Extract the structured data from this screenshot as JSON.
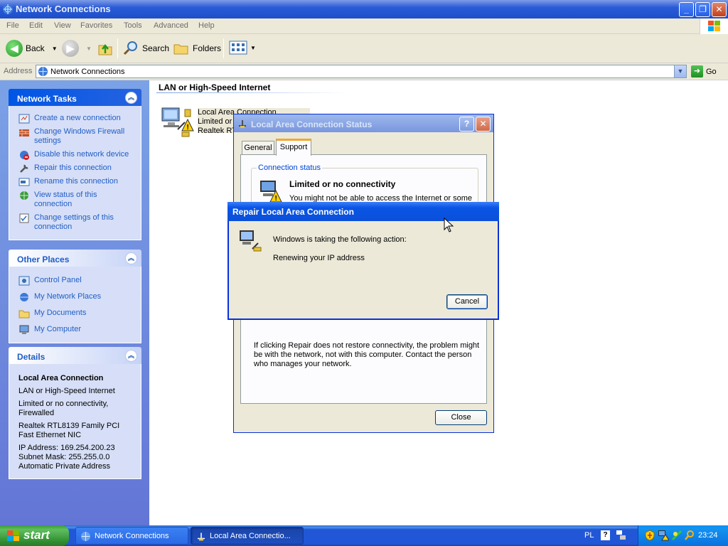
{
  "window": {
    "title": "Network Connections"
  },
  "menu": [
    "File",
    "Edit",
    "View",
    "Favorites",
    "Tools",
    "Advanced",
    "Help"
  ],
  "toolbar": {
    "back": "Back",
    "search": "Search",
    "folders": "Folders"
  },
  "address": {
    "label": "Address",
    "value": "Network Connections",
    "go": "Go"
  },
  "network_tasks": {
    "title": "Network Tasks",
    "items": [
      {
        "label": "Create a new connection",
        "icon": "new-connection-icon"
      },
      {
        "label": "Change Windows Firewall settings",
        "icon": "firewall-icon"
      },
      {
        "label": "Disable this network device",
        "icon": "disable-device-icon"
      },
      {
        "label": "Repair this connection",
        "icon": "repair-icon"
      },
      {
        "label": "Rename this connection",
        "icon": "rename-icon"
      },
      {
        "label": "View status of this connection",
        "icon": "status-icon"
      },
      {
        "label": "Change settings of this connection",
        "icon": "settings-icon"
      }
    ]
  },
  "other_places": {
    "title": "Other Places",
    "items": [
      {
        "label": "Control Panel",
        "icon": "control-panel-icon"
      },
      {
        "label": "My Network Places",
        "icon": "network-places-icon"
      },
      {
        "label": "My Documents",
        "icon": "documents-icon"
      },
      {
        "label": "My Computer",
        "icon": "computer-icon"
      }
    ]
  },
  "details": {
    "title": "Details",
    "name": "Local Area Connection",
    "type": "LAN or High-Speed Internet",
    "status": "Limited or no connectivity, Firewalled",
    "adapter": "Realtek RTL8139 Family PCI Fast Ethernet NIC",
    "ip": "IP Address: 169.254.200.23",
    "mask": "Subnet Mask: 255.255.0.0",
    "addr_type": "Automatic Private Address"
  },
  "content": {
    "group_title": "LAN or High-Speed Internet",
    "connection": {
      "name": "Local Area Connection",
      "line2": "Limited or",
      "line3": "Realtek RT"
    }
  },
  "status_dialog": {
    "title": "Local Area Connection Status",
    "tabs": [
      "General",
      "Support"
    ],
    "active_tab": "Support",
    "group_label": "Connection status",
    "status_heading": "Limited or no connectivity",
    "status_text": "You might not be able to access the Internet or some",
    "repair_note": "If clicking Repair does not restore connectivity, the problem might be with the network, not with this computer. Contact the person who manages your network.",
    "close": "Close"
  },
  "repair_dialog": {
    "title": "Repair Local Area Connection",
    "line1": "Windows is taking the following action:",
    "line2": "Renewing your IP address",
    "cancel": "Cancel"
  },
  "taskbar": {
    "start": "start",
    "buttons": [
      "Network Connections",
      "Local Area Connectio..."
    ],
    "language": "PL",
    "time": "23:24"
  },
  "colors": {
    "xp_blue": "#0a55e5",
    "sidebar": "#6f8fe0",
    "link": "#215dc6"
  }
}
